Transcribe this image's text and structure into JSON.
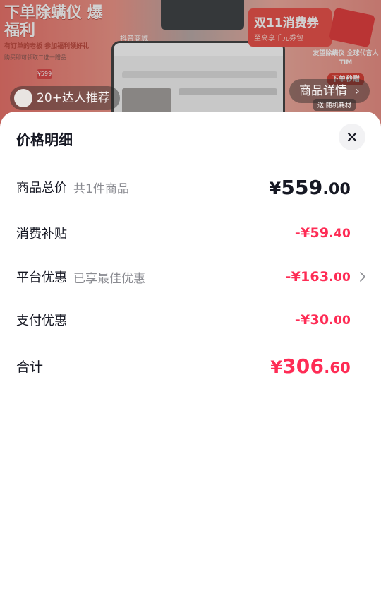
{
  "banner": {
    "promo_left_title": "下单除螨仪 爆福利",
    "promo_left_sub": "有订单的老板 参加福利领好礼",
    "promo_left_note": "购买即可领取二选一赠品",
    "price_tag": "¥599",
    "app_label": "抖音商城",
    "promo_right_title": "双11消费券",
    "promo_right_sub": "至高享千元券包",
    "promo_right_text": "友望除螨仪 全球代言人TIM",
    "promo_right_badge": "下单秒赠",
    "experts_label": "20+达人推荐",
    "details_label": "商品详情",
    "tag_text": "送 随机耗材"
  },
  "sheet": {
    "title": "价格明细",
    "rows": [
      {
        "label": "商品总价",
        "note": "共1件商品",
        "currency": "¥",
        "integer": "559",
        "decimal": ".00",
        "style": "black"
      },
      {
        "label": "消费补贴",
        "note": "",
        "currency": "-¥",
        "integer": "59",
        "decimal": ".40",
        "style": "red"
      },
      {
        "label": "平台优惠",
        "note": "已享最佳优惠",
        "currency": "-¥",
        "integer": "163",
        "decimal": ".00",
        "style": "red",
        "has_chevron": true
      },
      {
        "label": "支付优惠",
        "note": "",
        "currency": "-¥",
        "integer": "30",
        "decimal": ".00",
        "style": "red"
      }
    ],
    "total": {
      "label": "合计",
      "currency": "¥",
      "integer": "306",
      "decimal": ".60"
    }
  },
  "colors": {
    "accent_red": "#fe2c55",
    "text_primary": "#161823",
    "text_secondary": "#8a8b91"
  },
  "icons": {
    "close": "close-icon",
    "chevron": "chevron-right-icon"
  }
}
